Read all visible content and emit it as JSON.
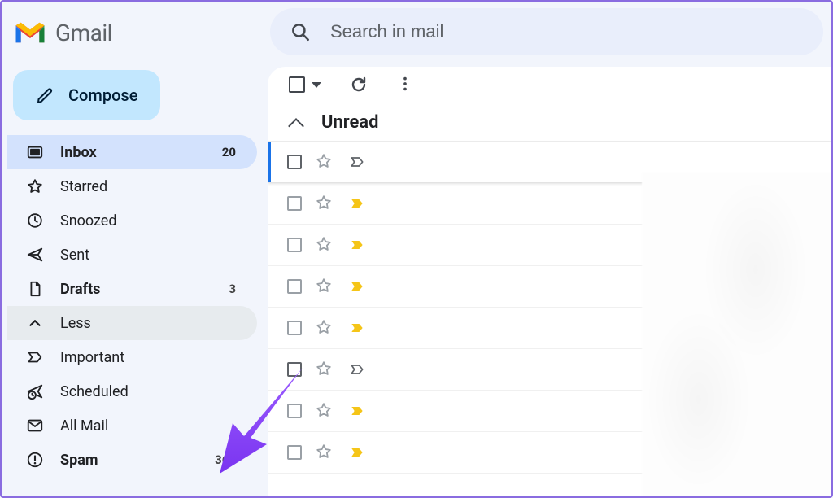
{
  "brand": "Gmail",
  "search": {
    "placeholder": "Search in mail"
  },
  "compose": {
    "label": "Compose"
  },
  "sidebar": {
    "items": [
      {
        "icon": "inbox-icon",
        "label": "Inbox",
        "count": "20",
        "active": true,
        "bold": true
      },
      {
        "icon": "star-icon",
        "label": "Starred",
        "count": "",
        "active": false,
        "bold": false
      },
      {
        "icon": "clock-icon",
        "label": "Snoozed",
        "count": "",
        "active": false,
        "bold": false
      },
      {
        "icon": "send-icon",
        "label": "Sent",
        "count": "",
        "active": false,
        "bold": false
      },
      {
        "icon": "file-icon",
        "label": "Drafts",
        "count": "3",
        "active": false,
        "bold": true
      },
      {
        "icon": "chevron-up-icon",
        "label": "Less",
        "count": "",
        "active": false,
        "bold": false,
        "less": true
      },
      {
        "icon": "tag-icon",
        "label": "Important",
        "count": "",
        "active": false,
        "bold": false
      },
      {
        "icon": "scheduled-icon",
        "label": "Scheduled",
        "count": "",
        "active": false,
        "bold": false
      },
      {
        "icon": "mail-icon",
        "label": "All Mail",
        "count": "",
        "active": false,
        "bold": false
      },
      {
        "icon": "spam-icon",
        "label": "Spam",
        "count": "362",
        "active": false,
        "bold": true
      }
    ]
  },
  "section": {
    "label": "Unread"
  },
  "rows": [
    {
      "selected": true,
      "checkbox": "unchecked",
      "star": "outline-gray",
      "tag": "outline-gray"
    },
    {
      "selected": false,
      "checkbox": "unchecked",
      "star": "outline-gray",
      "tag": "solid-yellow"
    },
    {
      "selected": false,
      "checkbox": "unchecked",
      "star": "outline-gray",
      "tag": "solid-yellow"
    },
    {
      "selected": false,
      "checkbox": "unchecked",
      "star": "outline-gray",
      "tag": "solid-yellow"
    },
    {
      "selected": false,
      "checkbox": "unchecked",
      "star": "outline-gray",
      "tag": "solid-yellow"
    },
    {
      "selected": false,
      "checkbox": "unchecked",
      "star": "outline-gray",
      "tag": "outline-gray",
      "strongchk": true
    },
    {
      "selected": false,
      "checkbox": "unchecked",
      "star": "outline-gray",
      "tag": "solid-yellow"
    },
    {
      "selected": false,
      "checkbox": "unchecked",
      "star": "outline-gray",
      "tag": "solid-yellow"
    }
  ],
  "colors": {
    "accent": "#1a73e8",
    "pill": "#c2e7fe",
    "activeNav": "#d3e2fd",
    "arrow": "#8a4af3"
  }
}
